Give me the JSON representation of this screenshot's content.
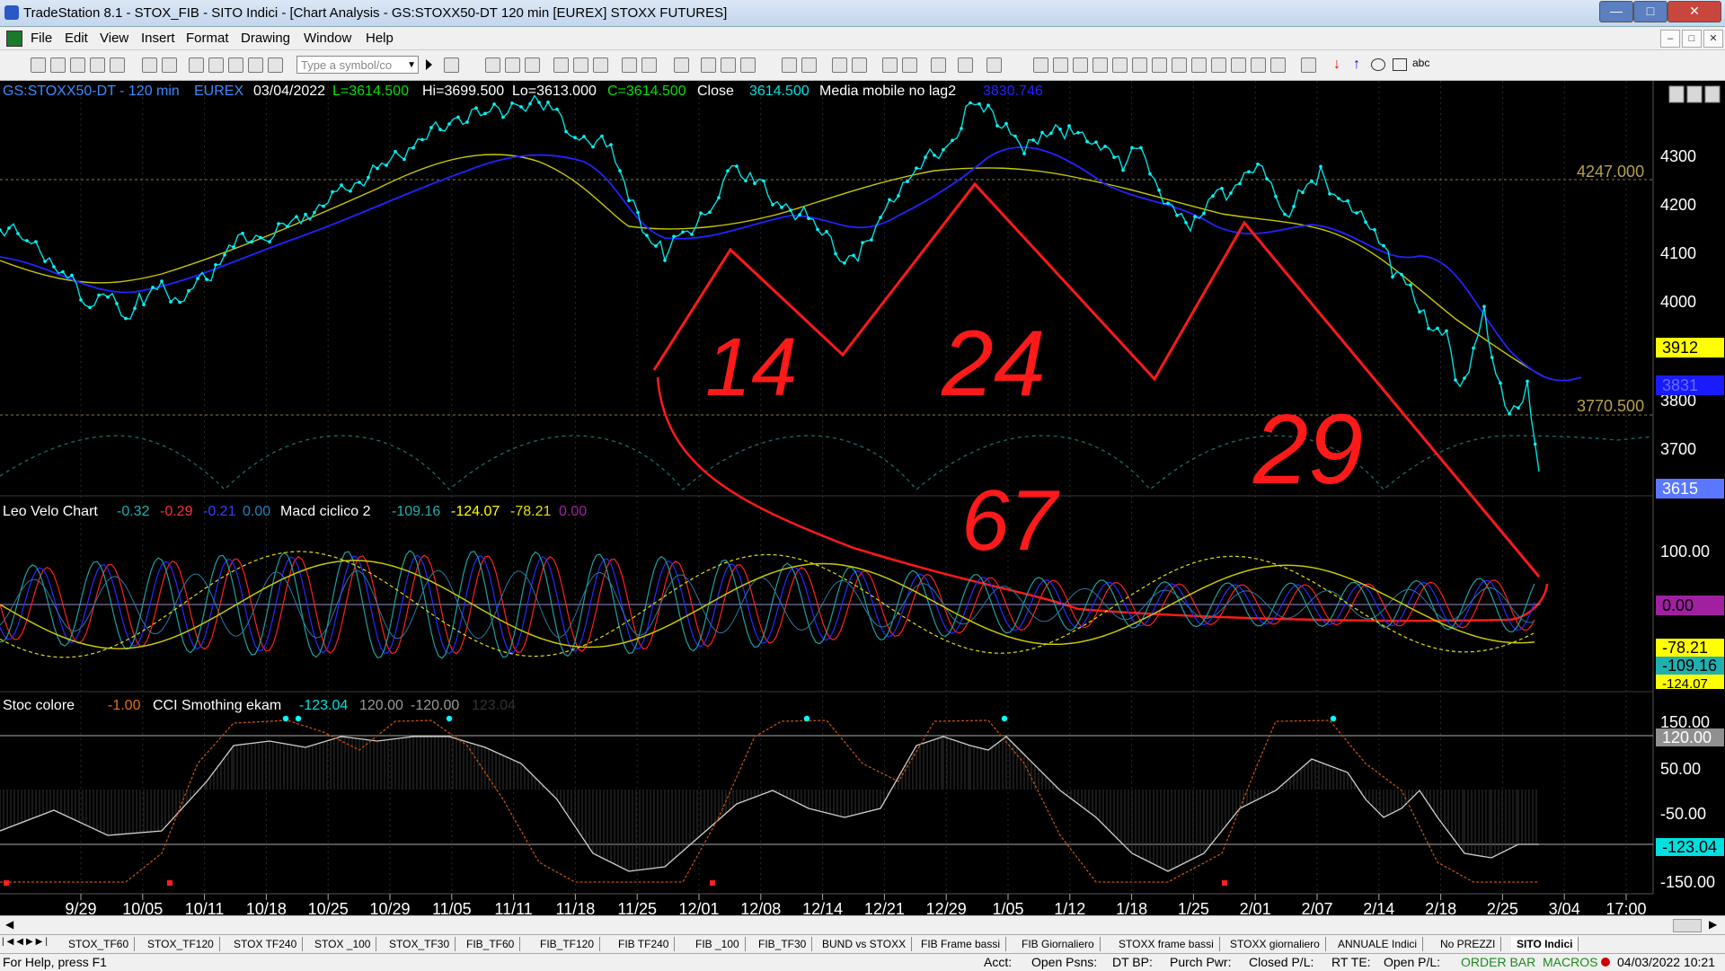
{
  "window": {
    "title": "TradeStation 8.1 - STOX_FIB - SITO Indici - [Chart Analysis - GS:STOXX50-DT  120 min  [EUREX] STOXX FUTURES]",
    "min": "—",
    "max": "□",
    "close": "✕"
  },
  "menu": {
    "items": [
      "File",
      "Edit",
      "View",
      "Insert",
      "Format",
      "Drawing",
      "Window",
      "Help"
    ],
    "mdi": [
      "–",
      "□",
      "✕"
    ]
  },
  "toolbar": {
    "symbol_placeholder": "Type a symbol/co",
    "draw_text": "abc"
  },
  "chart_header": {
    "symbol": "GS:STOXX50-DT - 120 min",
    "exchange": "EUREX",
    "date": "03/04/2022",
    "last": "L=3614.500",
    "hi": "Hi=3699.500",
    "lo": "Lo=3613.000",
    "close": "C=3614.500",
    "close_label": "Close",
    "close_value": "3614.500",
    "ma_label": "Media mobile no lag2",
    "ma_value": "3830.746"
  },
  "indicator1": {
    "name": "Leo Velo Chart",
    "v1": "-0.32",
    "v2": "-0.29",
    "v3": "-0.21",
    "v4": "0.00",
    "name2": "Macd ciclico 2",
    "v5": "-109.16",
    "v6": "-124.07",
    "v7": "-78.21",
    "v8": "0.00"
  },
  "indicator2": {
    "name": "Stoc colore",
    "v1": "-1.00",
    "name2": "CCI Smothing ekam",
    "v2": "-123.04",
    "v3": "120.00",
    "v4": "-120.00",
    "v5": "123.04"
  },
  "price_axis": {
    "ticks": [
      "4300",
      "4200",
      "4100",
      "4000",
      "3800",
      "3700"
    ],
    "level_high": "4247.000",
    "level_low": "3770.500",
    "box_3912": "3912",
    "box_3831": "3831",
    "box_last": "3615"
  },
  "ind1_axis": {
    "t100": "100.00",
    "zero": "0.00",
    "a": "-78.21",
    "b": "-109.16",
    "c": "-124.07"
  },
  "ind2_axis": {
    "t150": "150.00",
    "t120": "120.00",
    "t50": "50.00",
    "tm50": "-50.00",
    "cur": "-123.04",
    "tm150": "-150.00"
  },
  "time_axis": [
    "9/29",
    "10/05",
    "10/11",
    "10/18",
    "10/25",
    "10/29",
    "11/05",
    "11/11",
    "11/18",
    "11/25",
    "12/01",
    "12/08",
    "12/14",
    "12/21",
    "12/29",
    "1/05",
    "1/12",
    "1/18",
    "1/25",
    "2/01",
    "2/07",
    "2/14",
    "2/18",
    "2/25",
    "3/04",
    "17:00"
  ],
  "annotations": {
    "a": "14",
    "b": "24",
    "c": "29",
    "d": "67"
  },
  "tabs": [
    "STOX_TF60",
    "STOX_TF120",
    "STOX TF240",
    "STOX _100",
    "STOX_TF30",
    "FIB_TF60",
    "FIB_TF120",
    "FIB TF240",
    "FIB _100",
    "FIB_TF30",
    "BUND vs STOXX",
    "FIB Frame bassi",
    "FIB Giornaliero",
    "STOXX frame bassi",
    "STOXX giornaliero",
    "ANNUALE Indici",
    "No PREZZI",
    "SITO Indici"
  ],
  "status": {
    "help": "For Help, press F1",
    "acct": "Acct:",
    "open_psns": "Open Psns:",
    "dt_bp": "DT BP:",
    "purch_pwr": "Purch Pwr:",
    "closed_pl": "Closed P/L:",
    "rt_te": "RT TE:",
    "open_pl": "Open P/L:",
    "order_bar": "ORDER BAR",
    "macros": "MACROS",
    "datetime": "04/03/2022 10:21"
  },
  "colors": {
    "price": "#00ffff",
    "ma_blue": "#2222ff",
    "ma_yellow": "#c8c800",
    "annotation_red": "#ff1a1a",
    "level": "#b8a050",
    "box_yellow": "#ffff00",
    "box_blue": "#1a1aff",
    "box_purple": "#a020a0"
  }
}
